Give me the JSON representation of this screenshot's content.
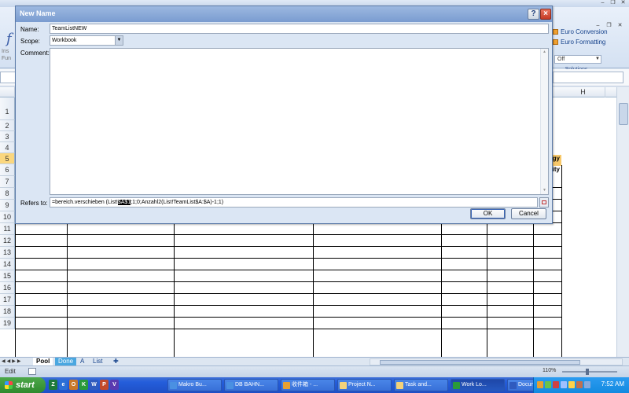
{
  "dialog": {
    "title": "New Name",
    "help_label": "?",
    "close_label": "×",
    "name_label": "Name:",
    "name_value": "TeamListNEW",
    "scope_label": "Scope:",
    "scope_value": "Workbook",
    "comment_label": "Comment:",
    "refers_label": "Refers to:",
    "refers_prefix": "=bereich.verschieben (List!",
    "refers_highlight": "$A$1",
    "refers_suffix": ";1;0;Anzahl2(List!TeamList$A:$A)-1;1)",
    "ok_label": "OK",
    "cancel_label": "Cancel"
  },
  "ribbon": {
    "left_labels": [
      "Ins",
      "Fun"
    ],
    "solutions_items": [
      "Euro Conversion",
      "Euro Formatting"
    ],
    "off_value": "Off",
    "solutions_label": "Solutions"
  },
  "grid": {
    "col_header_visible": "H",
    "rows": [
      "1",
      "2",
      "3",
      "4",
      "5",
      "6",
      "7",
      "8",
      "9",
      "10",
      "11",
      "12",
      "13",
      "14",
      "15",
      "16",
      "17",
      "18",
      "19"
    ],
    "selected_row": "5",
    "partial_header_cells": [
      "gy",
      "ity"
    ]
  },
  "sheets": {
    "tabs": [
      "Pool",
      "Done",
      "A",
      "List"
    ],
    "active": "Pool"
  },
  "status": {
    "mode": "Edit",
    "zoom": "110%"
  },
  "taskbar": {
    "start_label": "start",
    "quick_launch": [
      "Z",
      "e",
      "O",
      "K",
      "W",
      "P",
      "V"
    ],
    "tasks": [
      "Makro Bu...",
      "DB BAHN...",
      "收件箱 - ...",
      "Project N...",
      "Task and...",
      "Work Lo...",
      "Documen..."
    ],
    "active_task": "Work Lo...",
    "clock": "7:52 AM"
  },
  "colors": {
    "dialog_bg": "#dbe6f4",
    "title_gradient": "#7a9cd0",
    "taskbar": "#245edb",
    "start_green": "#2f8a2e",
    "highlight_row": "#fbd77e"
  }
}
